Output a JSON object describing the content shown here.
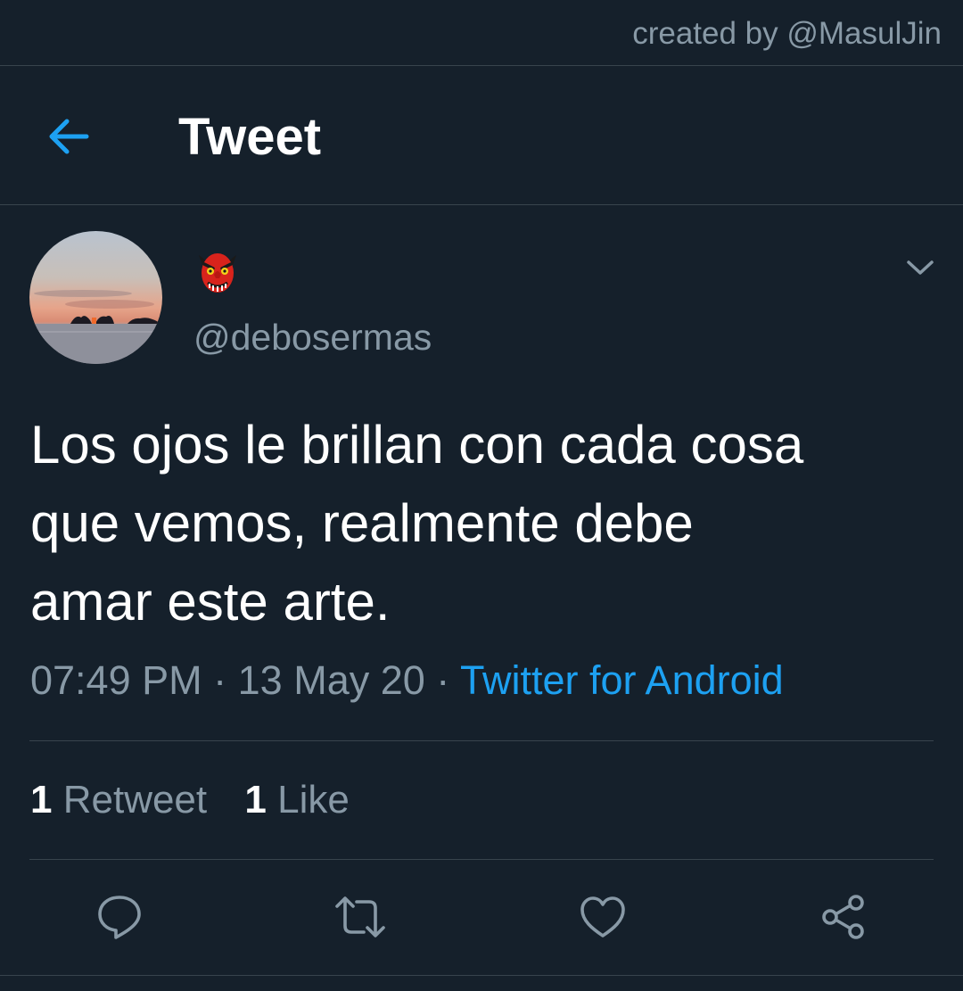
{
  "watermark": "created by @MasulJin",
  "header": {
    "title": "Tweet",
    "back_icon": "arrow-left-icon"
  },
  "tweet": {
    "display_name_emoji": "tengu-mask-emoji",
    "handle": "@debosermas",
    "text": "Los ojos le brillan con cada cosa\nque vemos, realmente debe\namar este arte.",
    "time": "07:49 PM",
    "separator": "·",
    "date": "13 May 20",
    "source": "Twitter for Android"
  },
  "stats": {
    "retweets_count": "1",
    "retweets_label": "Retweet",
    "likes_count": "1",
    "likes_label": "Like"
  },
  "actions": [
    "reply-icon",
    "retweet-icon",
    "like-icon",
    "share-icon"
  ],
  "colors": {
    "background": "#15202b",
    "accent": "#1da1f2",
    "muted_text": "#8899a6",
    "divider": "#38444d"
  }
}
